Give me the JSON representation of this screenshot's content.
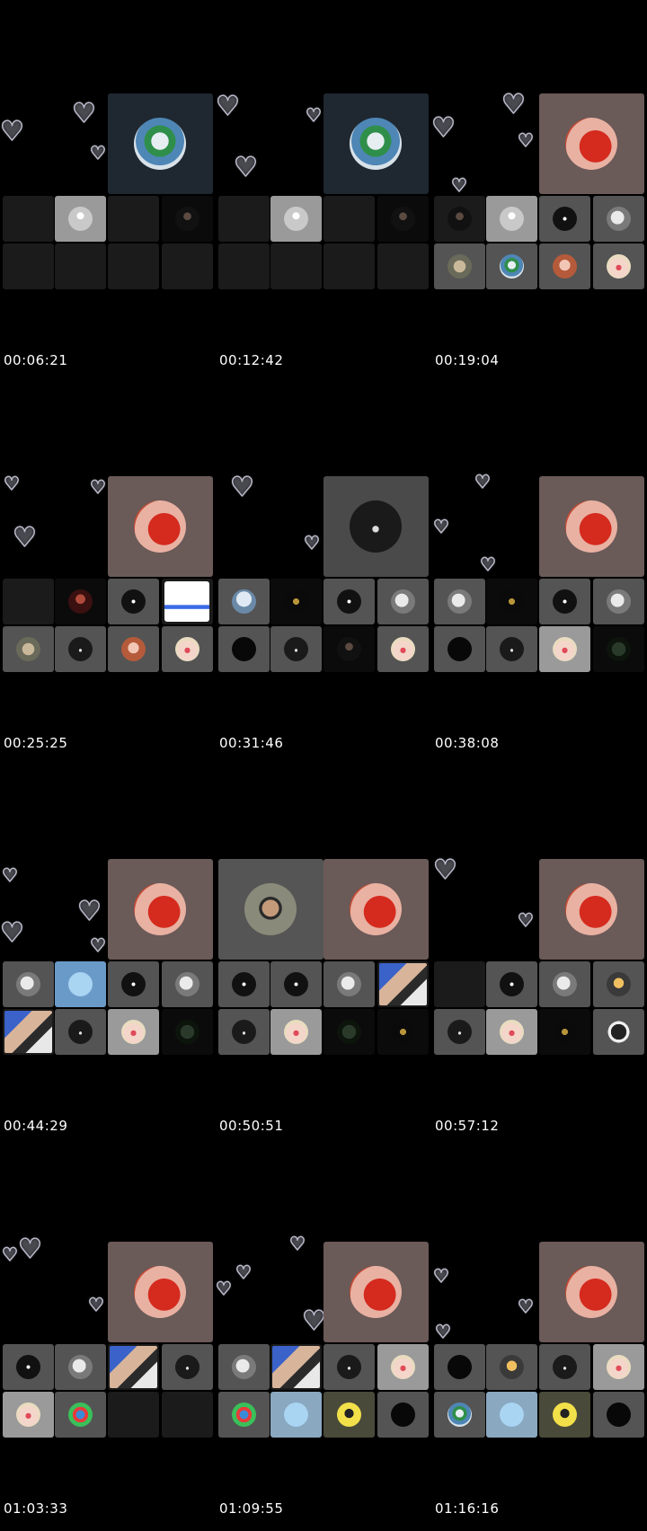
{
  "panels": [
    {
      "timestamp": "00:06:21",
      "host_avatar": "cybertruck-avatar"
    },
    {
      "timestamp": "00:12:42",
      "host_avatar": "cybertruck-avatar"
    },
    {
      "timestamp": "00:19:04",
      "host_avatar": "heart-face-avatar"
    },
    {
      "timestamp": "00:25:25",
      "host_avatar": "heart-face-avatar"
    },
    {
      "timestamp": "00:31:46",
      "host_avatar": "leather-jacket-avatar"
    },
    {
      "timestamp": "00:38:08",
      "host_avatar": "heart-face-avatar"
    },
    {
      "timestamp": "00:44:29",
      "host_avatar": "heart-face-avatar"
    },
    {
      "timestamp": "00:50:51",
      "host_avatar": "heart-face-avatar",
      "guest_avatar": "sunglasses-man-avatar"
    },
    {
      "timestamp": "00:57:12",
      "host_avatar": "heart-face-avatar"
    },
    {
      "timestamp": "01:03:33",
      "host_avatar": "heart-face-avatar"
    },
    {
      "timestamp": "01:09:55",
      "host_avatar": "heart-face-avatar"
    },
    {
      "timestamp": "01:16:16",
      "host_avatar": "heart-face-avatar"
    }
  ],
  "decoration": {
    "floating_icon": "heart-outline-icon"
  }
}
